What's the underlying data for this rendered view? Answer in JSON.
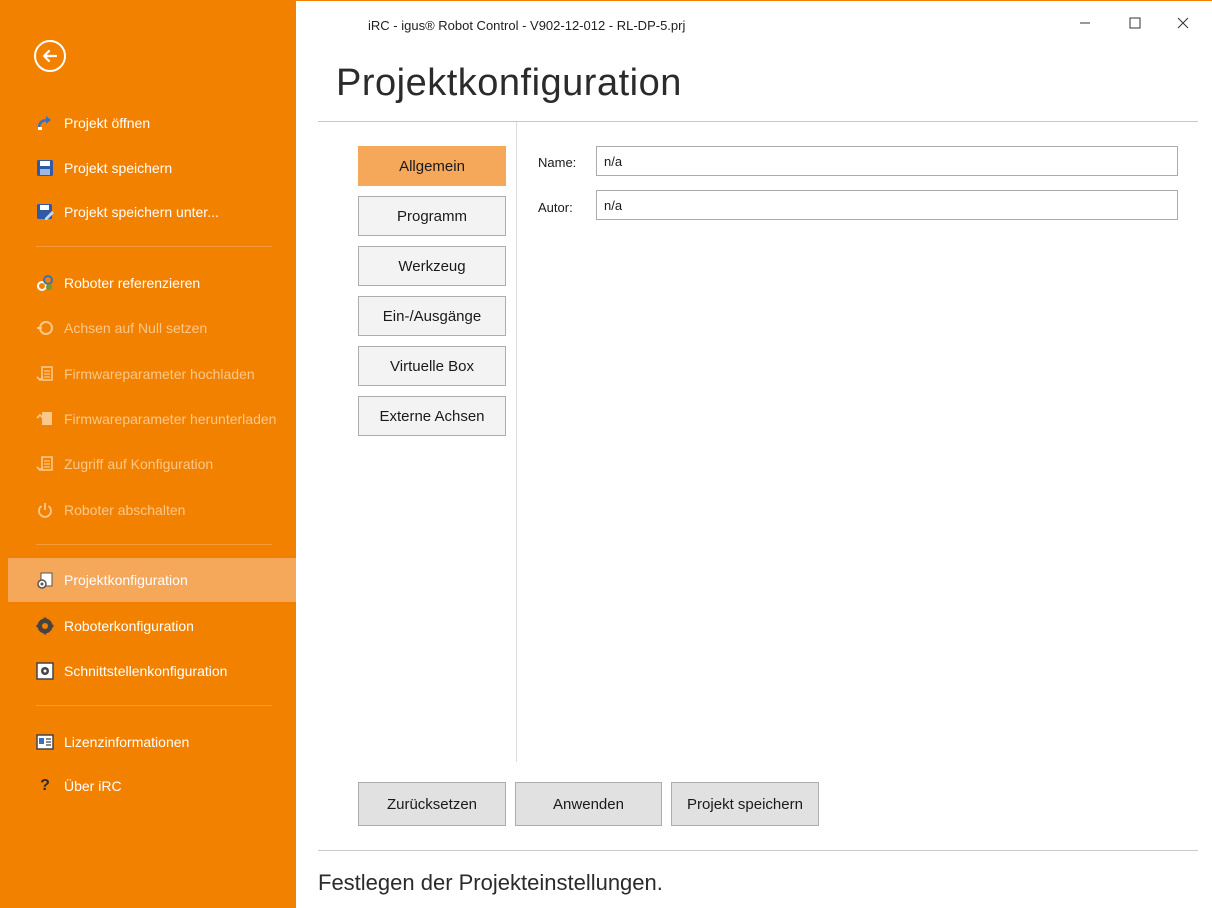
{
  "window": {
    "title": "iRC - igus® Robot Control - V902-12-012 - RL-DP-5.prj",
    "controls": [
      "minimize-icon",
      "maximize-icon",
      "close-icon"
    ]
  },
  "sidebar": {
    "back_icon": "back-arrow-icon",
    "items": [
      {
        "label": "Projekt öffnen",
        "icon": "open-project-icon",
        "enabled": true
      },
      {
        "label": "Projekt speichern",
        "icon": "save-icon",
        "enabled": true
      },
      {
        "label": "Projekt speichern unter...",
        "icon": "save-as-icon",
        "enabled": true
      },
      {
        "label": "Roboter referenzieren",
        "icon": "reference-icon",
        "enabled": true
      },
      {
        "label": "Achsen auf Null setzen",
        "icon": "zero-axes-icon",
        "enabled": false
      },
      {
        "label": "Firmwareparameter hochladen",
        "icon": "upload-icon",
        "enabled": false
      },
      {
        "label": "Firmwareparameter herunterladen",
        "icon": "download-icon",
        "enabled": false
      },
      {
        "label": "Zugriff auf Konfiguration",
        "icon": "config-access-icon",
        "enabled": false
      },
      {
        "label": "Roboter abschalten",
        "icon": "power-icon",
        "enabled": false
      },
      {
        "label": "Projektkonfiguration",
        "icon": "project-config-icon",
        "enabled": true,
        "selected": true
      },
      {
        "label": "Roboterkonfiguration",
        "icon": "gear-icon",
        "enabled": true
      },
      {
        "label": "Schnittstellenkonfiguration",
        "icon": "interface-config-icon",
        "enabled": true
      },
      {
        "label": "Lizenzinformationen",
        "icon": "license-icon",
        "enabled": true
      },
      {
        "label": "Über iRC",
        "icon": "help-icon",
        "enabled": true
      }
    ]
  },
  "main": {
    "title": "Projektkonfiguration",
    "categories": [
      {
        "label": "Allgemein",
        "selected": true
      },
      {
        "label": "Programm"
      },
      {
        "label": "Werkzeug"
      },
      {
        "label": "Ein-/Ausgänge"
      },
      {
        "label": "Virtuelle Box"
      },
      {
        "label": "Externe Achsen"
      }
    ],
    "fields": {
      "name": {
        "label": "Name:",
        "value": "n/a"
      },
      "author": {
        "label": "Autor:",
        "value": "n/a"
      }
    },
    "actions": {
      "reset": "Zurücksetzen",
      "apply": "Anwenden",
      "save_project": "Projekt speichern"
    },
    "footer": "Festlegen der Projekteinstellungen."
  },
  "colors": {
    "accent": "#f38100",
    "selected": "#f5a75a",
    "disabled_text": "#f9c88a"
  }
}
